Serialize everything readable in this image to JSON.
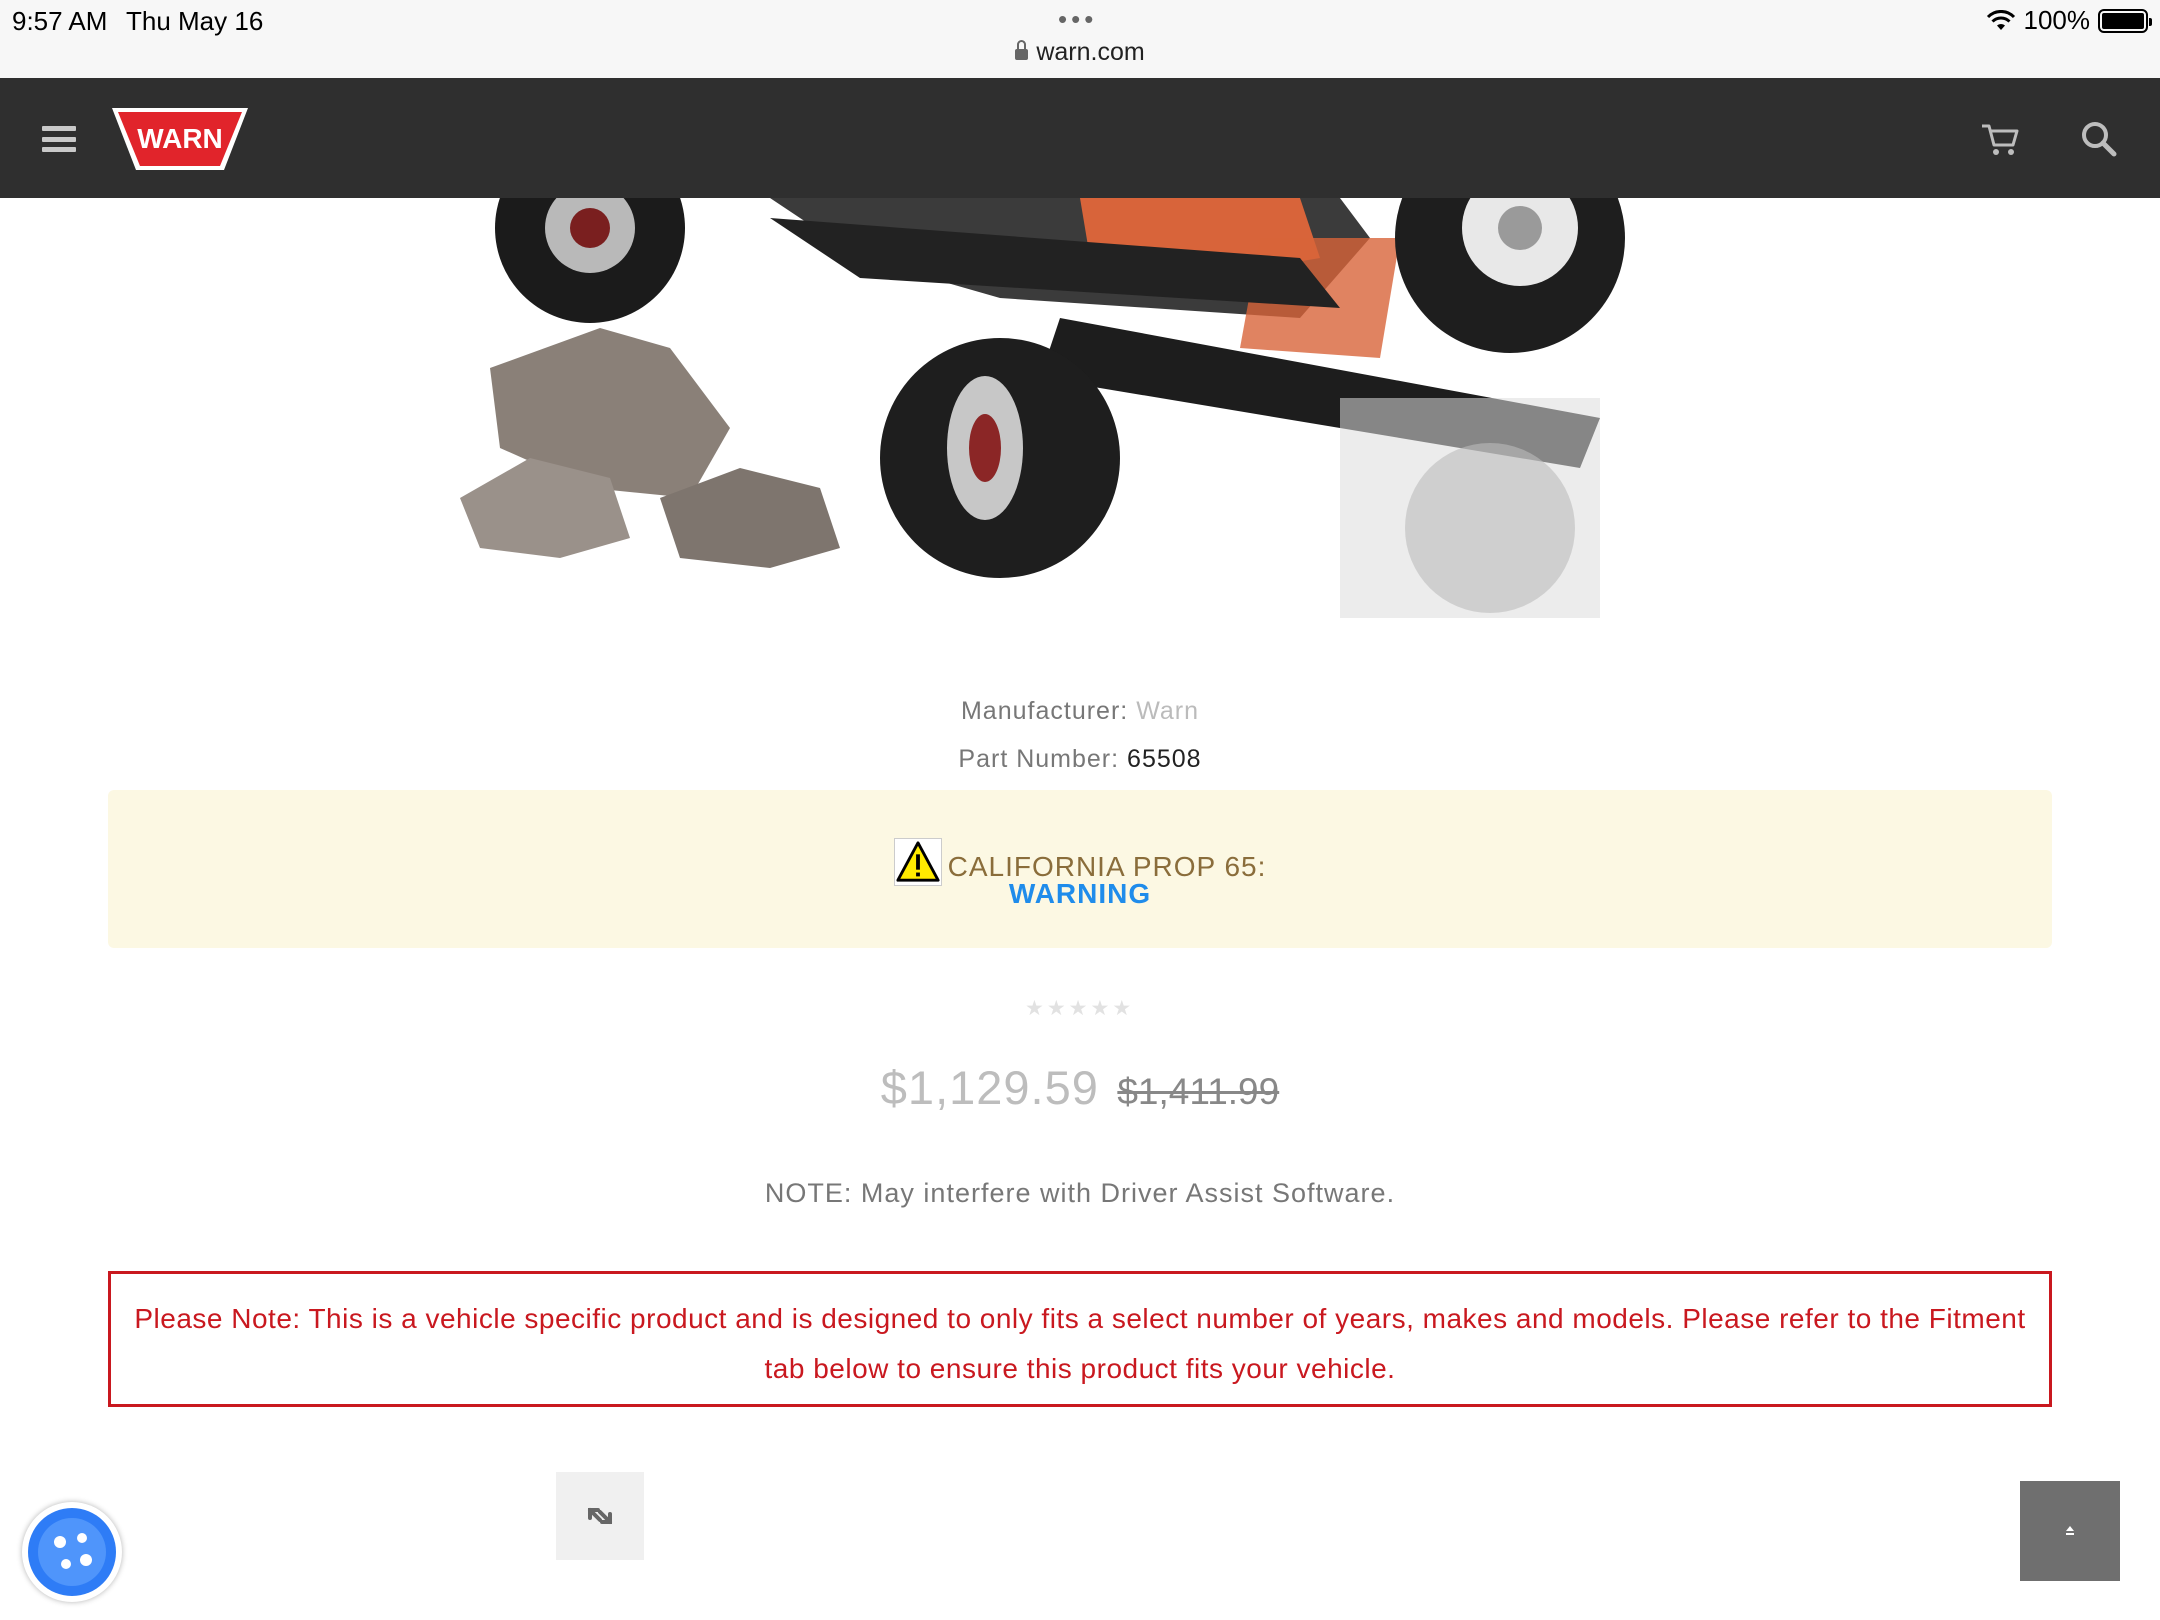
{
  "status_bar": {
    "time": "9:57 AM",
    "date": "Thu May 16",
    "dots": "•••",
    "battery": "100%",
    "url": "warn.com"
  },
  "header": {
    "logo_text": "WARN",
    "icons": [
      "menu-icon",
      "cart-icon",
      "search-icon"
    ],
    "logo_color": "#e1242b"
  },
  "product": {
    "manufacturer_label": "Manufacturer:",
    "manufacturer_value": "Warn",
    "part_label": "Part Number:",
    "part_value": "65508",
    "prop65_text": "CALIFORNIA PROP 65:",
    "prop65_link": "WARNING",
    "rating_stars": 0,
    "price_sale": "$1,129.59",
    "price_original": "$1,411.99",
    "note": "NOTE: May interfere with Driver Assist Software.",
    "fitment_notice": "Please Note: This is a vehicle specific product and is designed to only fits a select number of years, makes and models. Please refer to the Fitment tab below to ensure this product fits your vehicle."
  },
  "colors": {
    "header_bg": "#2f2f2f",
    "prop65_bg": "#fcf8e3",
    "link_blue": "#1f8ceb",
    "notice_red": "#c9181f"
  }
}
